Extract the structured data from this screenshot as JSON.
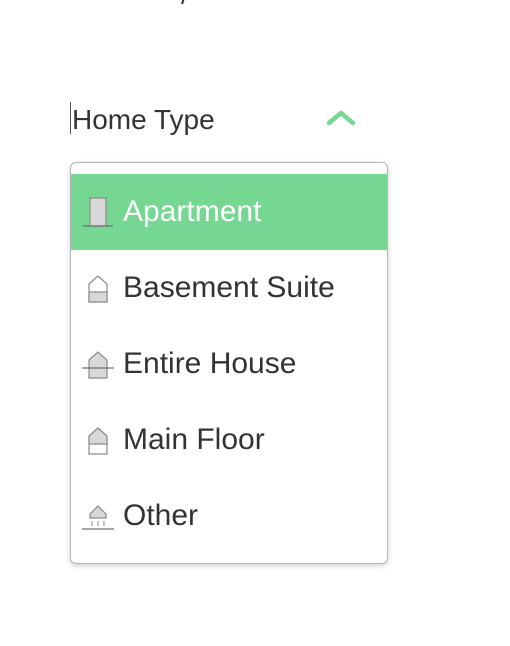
{
  "field": {
    "label": "Home Type",
    "expanded": true
  },
  "dropdown": {
    "options": [
      {
        "label": "Apartment",
        "icon": "apartment-icon",
        "selected": true
      },
      {
        "label": "Basement Suite",
        "icon": "basement-suite-icon",
        "selected": false
      },
      {
        "label": "Entire House",
        "icon": "entire-house-icon",
        "selected": false
      },
      {
        "label": "Main Floor",
        "icon": "main-floor-icon",
        "selected": false
      },
      {
        "label": "Other",
        "icon": "other-icon",
        "selected": false
      }
    ]
  },
  "colors": {
    "accent": "#76d793",
    "text": "#333333",
    "border": "#b5b5b5",
    "icon_fill": "#d8d8d8",
    "icon_stroke": "#8a8a8a"
  }
}
